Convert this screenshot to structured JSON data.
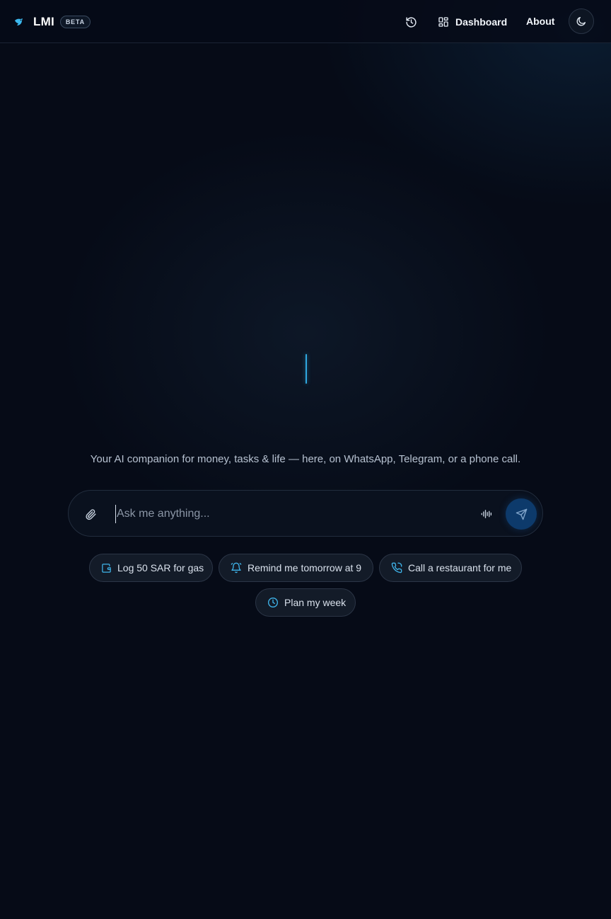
{
  "header": {
    "brand_name": "LMI",
    "badge": "BETA",
    "nav": {
      "dashboard_label": "Dashboard",
      "about_label": "About"
    },
    "icons": {
      "logo": "bird-logo-icon",
      "history": "history-icon",
      "dashboard": "grid-icon",
      "theme": "moon-icon"
    }
  },
  "main": {
    "tagline": "Your AI companion for money, tasks & life — here, on WhatsApp, Telegram, or a phone call."
  },
  "chat": {
    "placeholder": "Ask me anything...",
    "value": "",
    "icons": {
      "attach": "paperclip-icon",
      "voice": "audio-waveform-icon",
      "send": "send-icon"
    }
  },
  "suggestions": [
    {
      "label": "Log 50 SAR for gas",
      "icon": "wallet-icon"
    },
    {
      "label": "Remind me tomorrow at 9",
      "icon": "bell-icon"
    },
    {
      "label": "Call a restaurant for me",
      "icon": "phone-icon"
    },
    {
      "label": "Plan my week",
      "icon": "clock-icon"
    }
  ],
  "colors": {
    "background": "#060b17",
    "accent": "#2fa8e0",
    "send_button": "#0d3a6b",
    "chip_background": "#131b28"
  }
}
